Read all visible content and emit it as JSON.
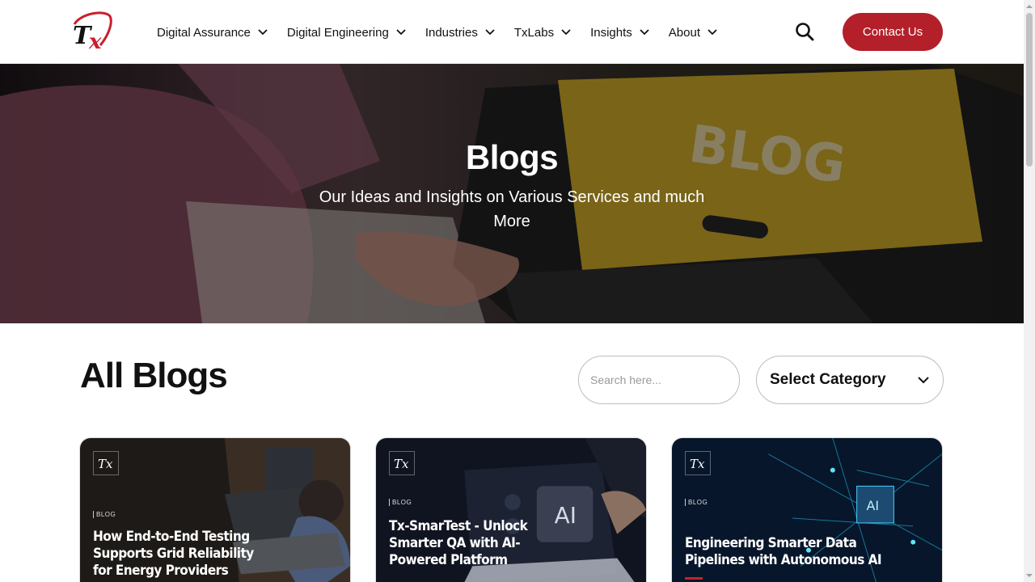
{
  "header": {
    "nav": [
      {
        "label": "Digital Assurance"
      },
      {
        "label": "Digital Engineering"
      },
      {
        "label": "Industries"
      },
      {
        "label": "TxLabs"
      },
      {
        "label": "Insights"
      },
      {
        "label": "About"
      }
    ],
    "contact_label": "Contact Us"
  },
  "hero": {
    "title": "Blogs",
    "subtitle": "Our Ideas and Insights on Various Services and much More",
    "laptop_screen_text": "BLOG"
  },
  "blogs": {
    "title": "All Blogs",
    "search_placeholder": "Search here...",
    "category_label": "Select Category",
    "cards": [
      {
        "tag": "BLOG",
        "title": "How End-to-End Testing Supports Grid Reliability for Energy Providers"
      },
      {
        "tag": "BLOG",
        "title": "Tx-SmarTest - Unlock Smarter QA with AI-Powered Platform"
      },
      {
        "tag": "BLOG",
        "title": "Engineering Smarter Data Pipelines with Autonomous AI"
      }
    ]
  },
  "colors": {
    "brand_red": "#b3202a",
    "accent_red": "#c8202c"
  },
  "icons": {
    "logo": "tx-logo-icon",
    "search": "search-icon",
    "chevron": "chevron-down-icon"
  }
}
